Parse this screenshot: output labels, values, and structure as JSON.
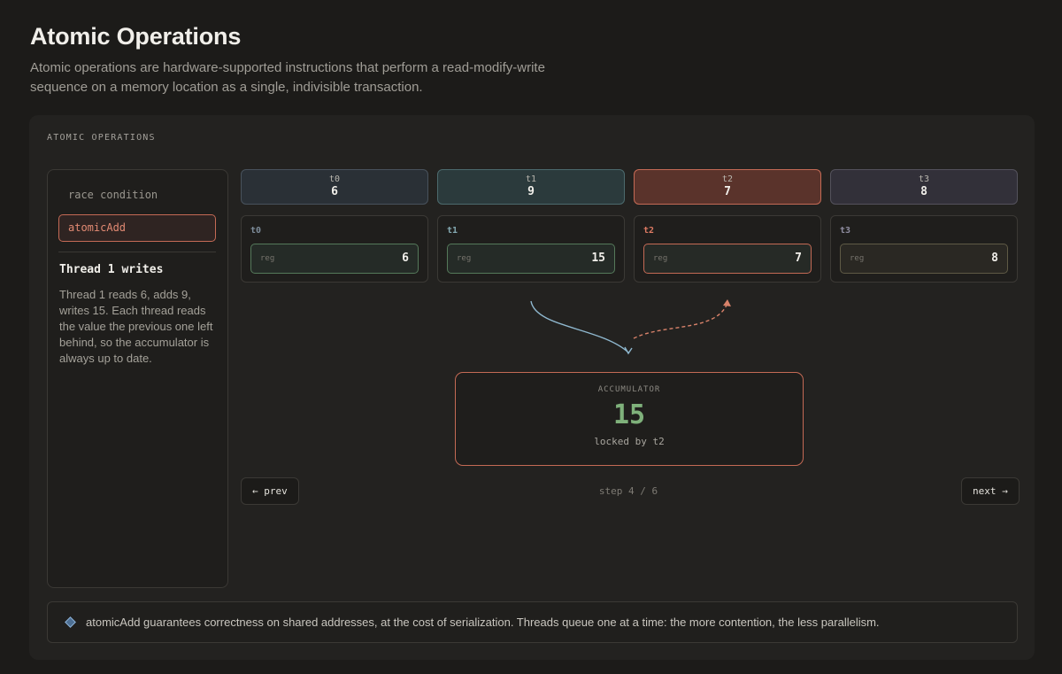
{
  "header": {
    "title": "Atomic Operations",
    "subtitle": "Atomic operations are hardware-supported instructions that perform a read-modify-write sequence on a memory location as a single, indivisible transaction."
  },
  "panel": {
    "label": "ATOMIC OPERATIONS"
  },
  "sidebar": {
    "modes": [
      {
        "label": "race condition",
        "selected": false
      },
      {
        "label": "atomicAdd",
        "selected": true
      }
    ],
    "step_title": "Thread 1 writes",
    "step_desc": "Thread 1 reads 6, adds 9, writes 15. Each thread reads the value the previous one left behind, so the accumulator is always up to date."
  },
  "threads": [
    {
      "name": "t0",
      "value": "6",
      "reg_label": "reg",
      "reg_value": "6"
    },
    {
      "name": "t1",
      "value": "9",
      "reg_label": "reg",
      "reg_value": "15"
    },
    {
      "name": "t2",
      "value": "7",
      "reg_label": "reg",
      "reg_value": "7",
      "active": true
    },
    {
      "name": "t3",
      "value": "8",
      "reg_label": "reg",
      "reg_value": "8"
    }
  ],
  "accumulator": {
    "label": "ACCUMULATOR",
    "value": "15",
    "status": "locked by t2"
  },
  "nav": {
    "prev": "← prev",
    "next": "next →",
    "step": "step 4 / 6"
  },
  "note": {
    "text": "atomicAdd guarantees correctness on shared addresses, at the cost of serialization. Threads queue one at a time: the more contention, the less parallelism."
  },
  "colors": {
    "accent": "#c46a55",
    "success": "#7fb17b",
    "read_arrow": "#8fb8cf",
    "write_arrow": "#d9826a"
  }
}
